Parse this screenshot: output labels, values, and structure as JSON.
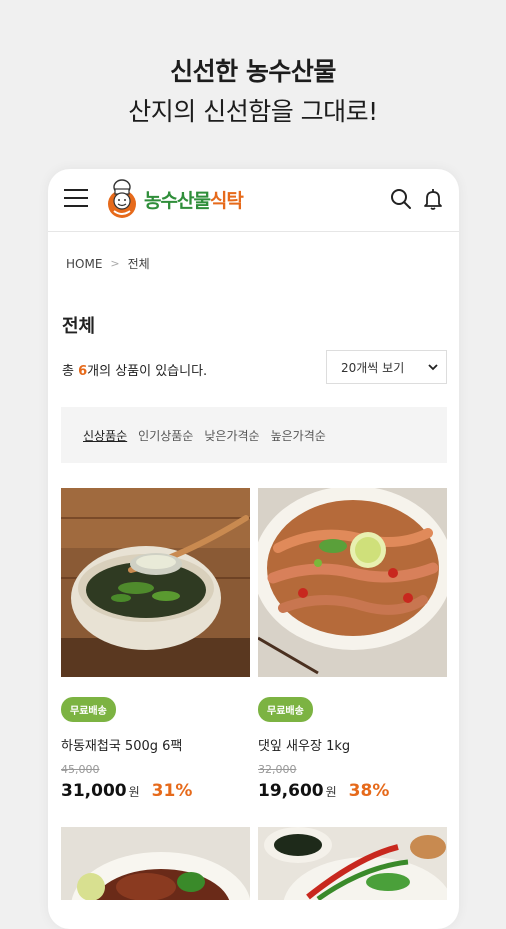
{
  "promo": {
    "line1": "신선한 농수산물",
    "line2": "산지의 신선함을 그대로!"
  },
  "header": {
    "logo": {
      "text_green": "농수산물",
      "text_orange": "식탁"
    }
  },
  "breadcrumb": {
    "home": "HOME",
    "separator": ">",
    "current": "전체"
  },
  "listing": {
    "title": "전체",
    "count_prefix": "총 ",
    "count_num": "6",
    "count_suffix": "개의 상품이 있습니다.",
    "view_select": "20개씩 보기",
    "sort_options": [
      "신상품순",
      "인기상품순",
      "낮은가격순",
      "높은가격순"
    ],
    "active_sort": "신상품순"
  },
  "products": [
    {
      "badge": "무료배송",
      "name": "하동재첩국 500g 6팩",
      "original_price": "45,000",
      "price": "31,000",
      "currency": "원",
      "discount": "31%"
    },
    {
      "badge": "무료배송",
      "name": "댓잎 새우장 1kg",
      "original_price": "32,000",
      "price": "19,600",
      "currency": "원",
      "discount": "38%"
    }
  ],
  "colors": {
    "accent_orange": "#e66a1b",
    "brand_green": "#2f8e3a",
    "badge_green": "#7cb342"
  },
  "icons": [
    "menu-icon",
    "search-icon",
    "bell-icon",
    "chevron-down-icon"
  ]
}
